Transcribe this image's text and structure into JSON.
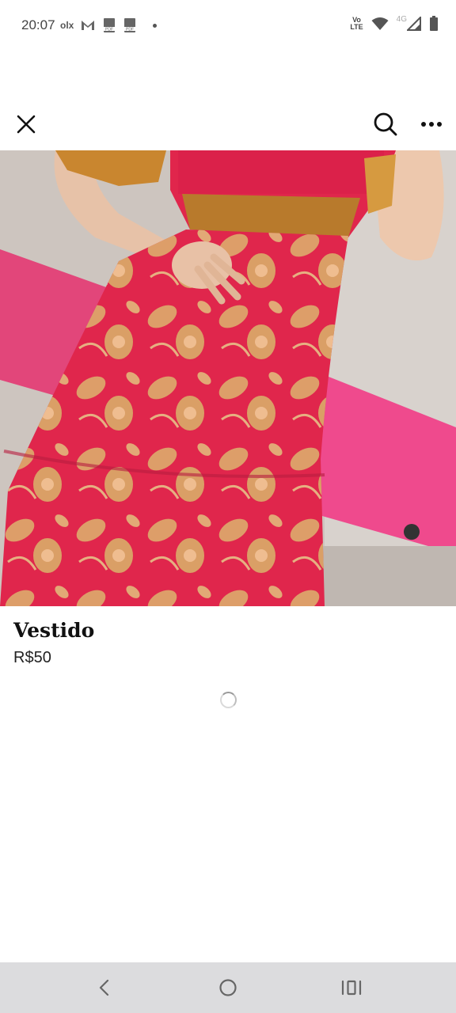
{
  "status_bar": {
    "time": "20:07",
    "notification_icons": [
      "olx-icon",
      "gmail-icon",
      "pdf-icon",
      "pdf-icon",
      "dot-icon"
    ],
    "olx_label": "olx",
    "volte_label": "Vo\nLTE",
    "network_label": "4G",
    "system_icons": [
      "volte-icon",
      "wifi-icon",
      "signal-icon",
      "battery-icon"
    ]
  },
  "header": {
    "close_icon": "close-icon",
    "search_icon": "search-icon",
    "more_icon": "more-horizontal-icon"
  },
  "listing": {
    "photo": "red floral maxi dress photo",
    "title": "Vestido",
    "price": "R$50"
  },
  "loading": {
    "icon": "loading-spinner-icon"
  },
  "nav_bar": {
    "buttons": [
      "back-icon",
      "home-icon",
      "recents-icon"
    ]
  },
  "colors": {
    "dress_red": "#e0264c",
    "pattern_gold": "#d9b46a",
    "nav_bg": "#dcdcde"
  }
}
